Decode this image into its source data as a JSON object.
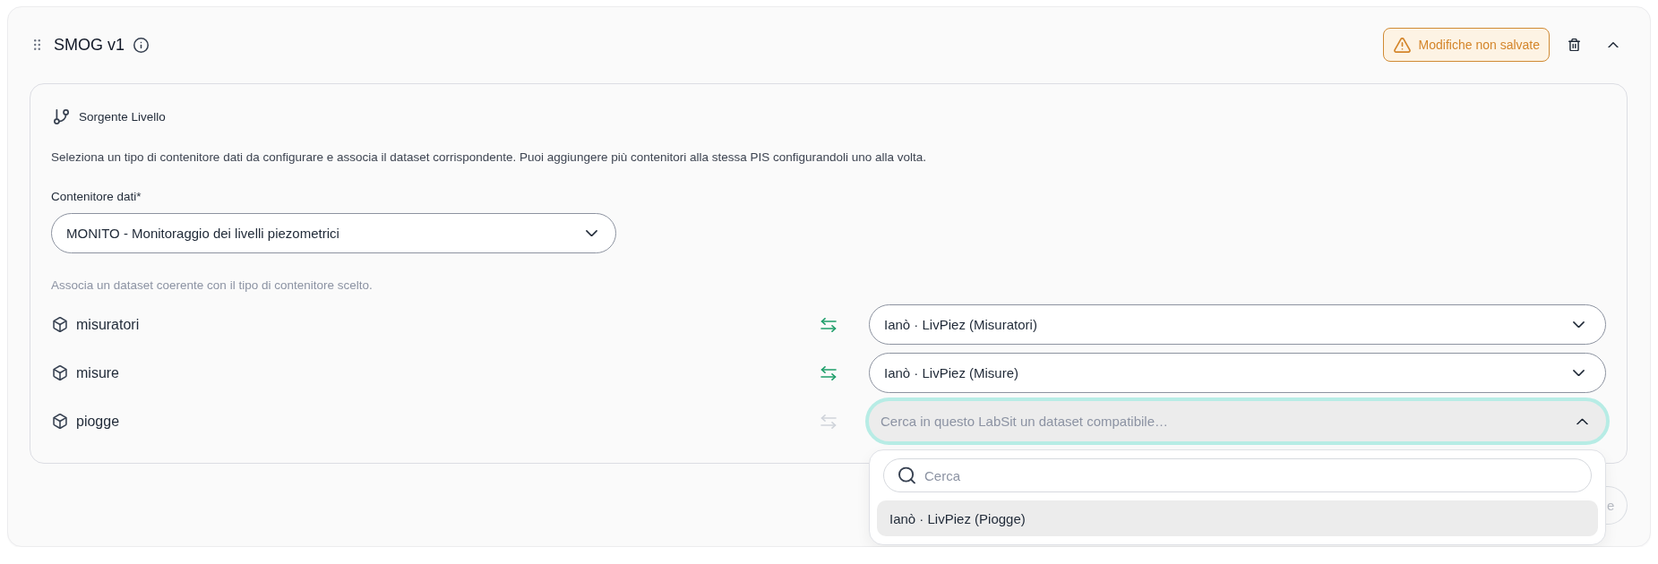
{
  "card": {
    "title": "SMOG v1",
    "unsaved_badge": "Modifiche non salvate",
    "expanded": true
  },
  "section": {
    "title": "Sorgente Livello",
    "description": "Seleziona un tipo di contenitore dati da configurare e associa il dataset corrispondente. Puoi aggiungere più contenitori alla stessa PIS configurandoli uno alla volta.",
    "container_field": {
      "label": "Contenitore dati*",
      "value": "MONITO - Monitoraggio dei livelli piezometrici"
    },
    "hint": "Associa un dataset coerente con il tipo di contenitore scelto.",
    "rows": [
      {
        "name": "misuratori",
        "linked": true,
        "value": "Ianò · LivPiez (Misuratori)",
        "open": false
      },
      {
        "name": "misure",
        "linked": true,
        "value": "Ianò · LivPiez (Misure)",
        "open": false
      },
      {
        "name": "piogge",
        "linked": false,
        "placeholder": "Cerca in questo LabSit un dataset compatibile…",
        "open": true,
        "dropdown": {
          "search": {
            "placeholder": "Cerca"
          },
          "options": [
            {
              "label": "Ianò · LivPiez (Piogge)",
              "highlighted": true
            }
          ]
        }
      }
    ]
  },
  "footer": {
    "button": {
      "label": "e",
      "disabled": true
    }
  }
}
